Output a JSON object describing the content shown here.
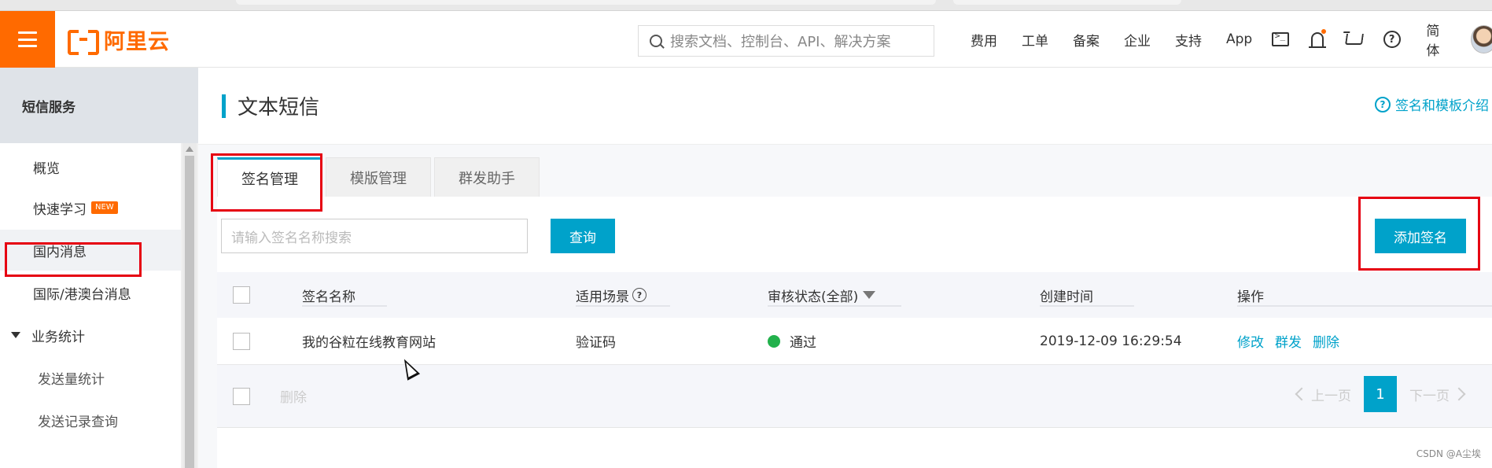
{
  "topbar": {
    "logo_text": "阿里云",
    "search_placeholder": "搜索文档、控制台、API、解决方案",
    "nav": [
      "费用",
      "工单",
      "备案",
      "企业",
      "支持",
      "App"
    ],
    "lang": "简体",
    "accent_color": "#ff6a00"
  },
  "sidebar": {
    "title": "短信服务",
    "items": {
      "overview": "概览",
      "quickstart": "快速学习",
      "quickstart_badge": "NEW",
      "domestic": "国内消息",
      "international": "国际/港澳台消息",
      "stats_group": "业务统计",
      "send_stats": "发送量统计",
      "send_records": "发送记录查询"
    }
  },
  "page": {
    "title": "文本短信",
    "intro_link": "签名和模板介绍",
    "tabs": [
      "签名管理",
      "模版管理",
      "群发助手"
    ],
    "active_tab": "签名管理"
  },
  "filter": {
    "placeholder": "请输入签名名称搜索",
    "query_button": "查询",
    "add_button": "添加签名"
  },
  "table": {
    "headers": {
      "name": "签名名称",
      "scene": "适用场景",
      "status": "审核状态(全部)",
      "created": "创建时间",
      "actions": "操作"
    },
    "rows": [
      {
        "name": "我的谷粒在线教育网站",
        "scene": "验证码",
        "status": "通过",
        "created": "2019-12-09 16:29:54",
        "actions": [
          "修改",
          "群发",
          "删除"
        ]
      }
    ],
    "footer_delete": "删除"
  },
  "pagination": {
    "prev": "上一页",
    "current": "1",
    "next": "下一页"
  },
  "watermark": "CSDN @A尘埃",
  "colors": {
    "primary": "#00a2ca",
    "brand": "#ff6a00",
    "highlight_box": "#e60012",
    "status_ok": "#22b14c"
  }
}
